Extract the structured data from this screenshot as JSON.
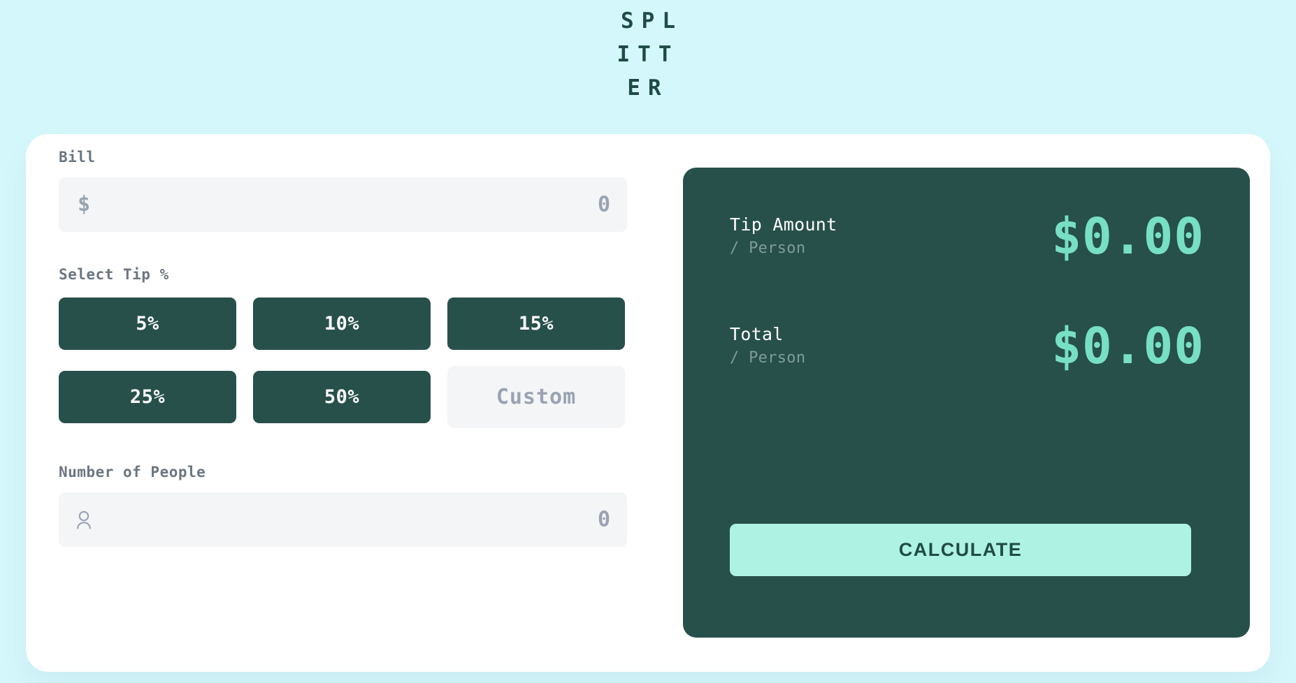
{
  "app": {
    "title": "SPLITTER",
    "background_color": "#d4f7fb",
    "accent_dark": "#27504b",
    "accent_mint": "#77dfc4",
    "button_mint": "#aef2e3"
  },
  "bill": {
    "label": "Bill",
    "icon": "dollar-icon",
    "icon_glyph": "$",
    "value": "0",
    "placeholder": "0"
  },
  "tip": {
    "label": "Select Tip %",
    "options": [
      {
        "label": "5%",
        "value": 5,
        "selected": false
      },
      {
        "label": "10%",
        "value": 10,
        "selected": false
      },
      {
        "label": "15%",
        "value": 15,
        "selected": false
      },
      {
        "label": "25%",
        "value": 25,
        "selected": false
      },
      {
        "label": "50%",
        "value": 50,
        "selected": false
      }
    ],
    "custom": {
      "placeholder": "Custom",
      "value": ""
    }
  },
  "people": {
    "label": "Number of People",
    "icon": "person-icon",
    "value": "0",
    "placeholder": "0"
  },
  "results": {
    "rows": [
      {
        "title": "Tip Amount",
        "subtitle": "/ Person",
        "value": "$0.00"
      },
      {
        "title": "Total",
        "subtitle": "/ Person",
        "value": "$0.00"
      }
    ],
    "calculate_label": "CALCULATE"
  }
}
